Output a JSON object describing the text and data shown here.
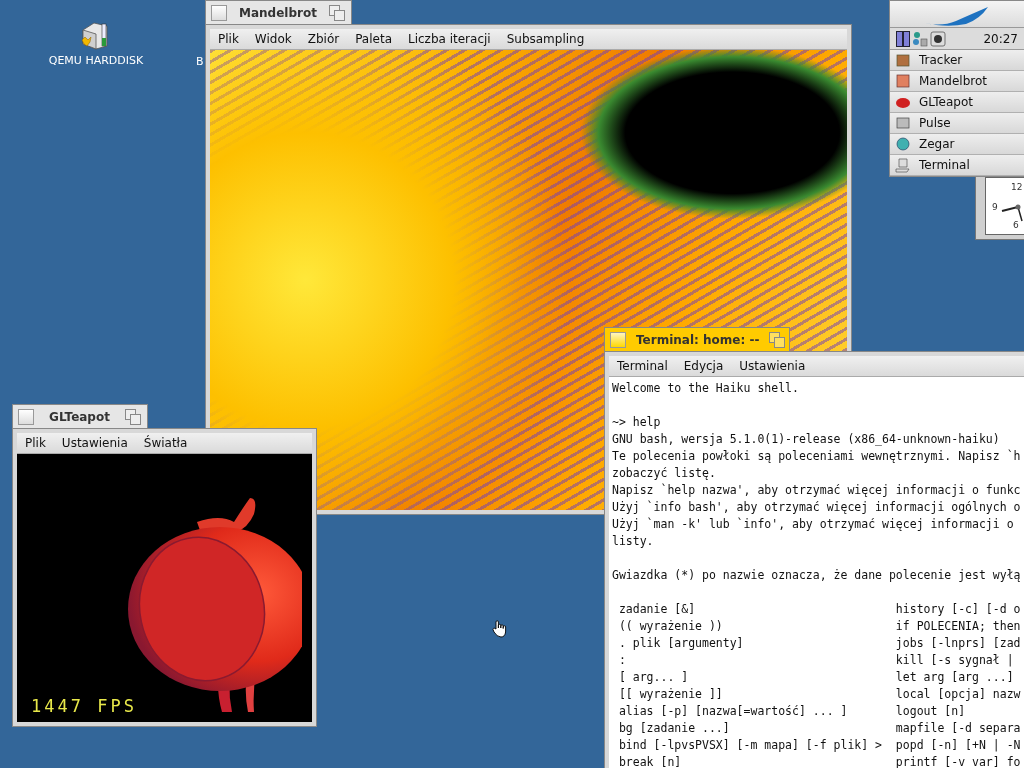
{
  "desktop_icons": [
    {
      "kind": "drive",
      "label": "QEMU HARDDISK"
    },
    {
      "kind": "hidden",
      "label": "B"
    }
  ],
  "windows": [
    {
      "kind": "mandelbrot",
      "title": "Mandelbrot",
      "focused": false,
      "menu": [
        "Plik",
        "Widok",
        "Zbiór",
        "Paleta",
        "Liczba iteracji",
        "Subsampling"
      ]
    },
    {
      "kind": "teapot",
      "title": "GLTeapot",
      "focused": false,
      "menu": [
        "Plik",
        "Ustawienia",
        "Światła"
      ],
      "fps": "1447 FPS"
    },
    {
      "kind": "terminal",
      "title": "Terminal: home: --",
      "focused": true,
      "menu": [
        "Terminal",
        "Edycja",
        "Ustawienia"
      ],
      "blocks": [
        [
          "Welcome to the Haiku shell."
        ],
        [
          "~> help",
          "GNU bash, wersja 5.1.0(1)-release (x86_64-unknown-haiku)",
          "Te polecenia powłoki są poleceniami wewnętrznymi. Napisz `h",
          "zobaczyć listę.",
          "Napisz `help nazwa', aby otrzymać więcej informacji o funkc",
          "Użyj `info bash', aby otrzymać więcej informacji ogólnych o",
          "Użyj `man -k' lub `info', aby otrzymać więcej informacji o",
          "listy."
        ],
        [
          "Gwiazdka (*) po nazwie oznacza, że dane polecenie jest wyłą"
        ]
      ],
      "commands": [
        {
          "left": "zadanie [&]",
          "right": "history [-c] [-d o"
        },
        {
          "left": "(( wyrażenie ))",
          "right": "if POLECENIA; then"
        },
        {
          "left": ". plik [argumenty]",
          "right": "jobs [-lnprs] [zad"
        },
        {
          "left": ":",
          "right": "kill [-s sygnał |"
        },
        {
          "left": "[ arg... ]",
          "right": "let arg [arg ...]"
        },
        {
          "left": "[[ wyrażenie ]]",
          "right": "local [opcja] nazw"
        },
        {
          "left": "alias [-p] [nazwa[=wartość] ... ]",
          "right": "logout [n]"
        },
        {
          "left": "bg [zadanie ...]",
          "right": "mapfile [-d separa"
        },
        {
          "left": "bind [-lpvsPVSX] [-m mapa] [-f plik] >",
          "right": "popd [-n] [+N | -N"
        },
        {
          "left": "break [n]",
          "right": "printf [-v var] fo"
        }
      ]
    }
  ],
  "clock": {
    "numerals": [
      "12",
      "9",
      "6"
    ]
  },
  "deskbar": {
    "time": "20:27",
    "items": [
      {
        "label": "Tracker"
      },
      {
        "label": "Mandelbrot"
      },
      {
        "label": "GLTeapot"
      },
      {
        "label": "Pulse"
      },
      {
        "label": "Zegar"
      },
      {
        "label": "Terminal"
      }
    ]
  }
}
